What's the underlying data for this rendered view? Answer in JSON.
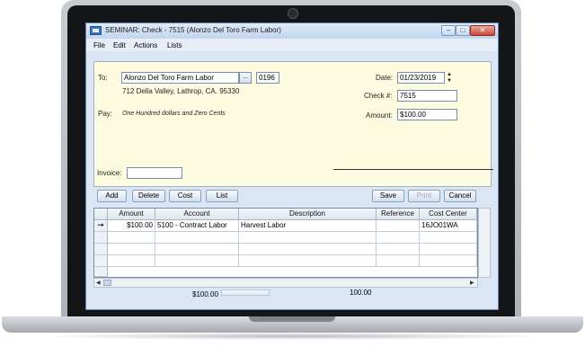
{
  "window": {
    "title": "SEMINAR: Check - 7515 (Alonzo Del Toro Farm Labor)",
    "controls": {
      "minimize": "–",
      "maximize": "□",
      "close": "✕"
    }
  },
  "menu": [
    "File",
    "Edit",
    "Actions",
    "Lists"
  ],
  "check": {
    "to_label": "To:",
    "payee": "Alonzo Del Toro Farm Labor",
    "lookup_label": "...",
    "payee_code": "0196",
    "address": "712 Della Valley, Lathrop, CA. 95330",
    "pay_label": "Pay:",
    "amount_words": "One Hundred dollars and Zero Cents",
    "date_label": "Date:",
    "date": "01/23/2019",
    "check_num_label": "Check #:",
    "check_num": "7515",
    "amount_label": "Amount:",
    "amount": "$100.00",
    "invoice_label": "Invoice:",
    "invoice": ""
  },
  "buttons": {
    "add": "Add",
    "delete": "Delete",
    "cost": "Cost",
    "list": "List",
    "save": "Save",
    "print": "Print",
    "cancel": "Cancel"
  },
  "grid": {
    "headers": [
      "Amount",
      "Account",
      "Description",
      "Reference",
      "Cost Center"
    ],
    "rows": [
      {
        "amount": "$100.00",
        "account": "5100 - Contract Labor",
        "description": "Harvest Labor",
        "reference": "",
        "cost_center": "16JO01WA"
      }
    ],
    "row_indicator": "➞"
  },
  "totals": {
    "amount": "$100.00",
    "distribution": "100.00"
  },
  "colors": {
    "check_bg": "#fdfce0",
    "window_bg": "#dbe6f4"
  }
}
